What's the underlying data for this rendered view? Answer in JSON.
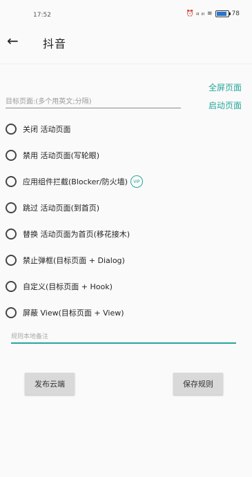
{
  "status_bar": {
    "time": "17:52",
    "icons_text": "⏰ ᵢₗₗ ᵢₗₗ",
    "battery_text": "78"
  },
  "toolbar": {
    "title": "抖音"
  },
  "links": {
    "fullscreen": "全屏页面",
    "launch": "启动页面"
  },
  "target_input": {
    "placeholder": "目标页面:(多个用英文;分隔)"
  },
  "options": [
    {
      "label": "关闭 活动页面"
    },
    {
      "label": "禁用 活动页面(写轮眼)"
    },
    {
      "label": "应用组件拦截(Blocker/防火墙)",
      "badge": "VIP"
    },
    {
      "label": "跳过 活动页面(到首页)"
    },
    {
      "label": "替换 活动页面为首页(移花接木)"
    },
    {
      "label": "禁止弹框(目标页面 + Dialog)"
    },
    {
      "label": "自定义(目标页面 + Hook)"
    },
    {
      "label": "屏蔽 View(目标页面 + View)"
    }
  ],
  "note_input": {
    "placeholder": "规则本地备注"
  },
  "buttons": {
    "publish": "发布云端",
    "save": "保存规则"
  }
}
